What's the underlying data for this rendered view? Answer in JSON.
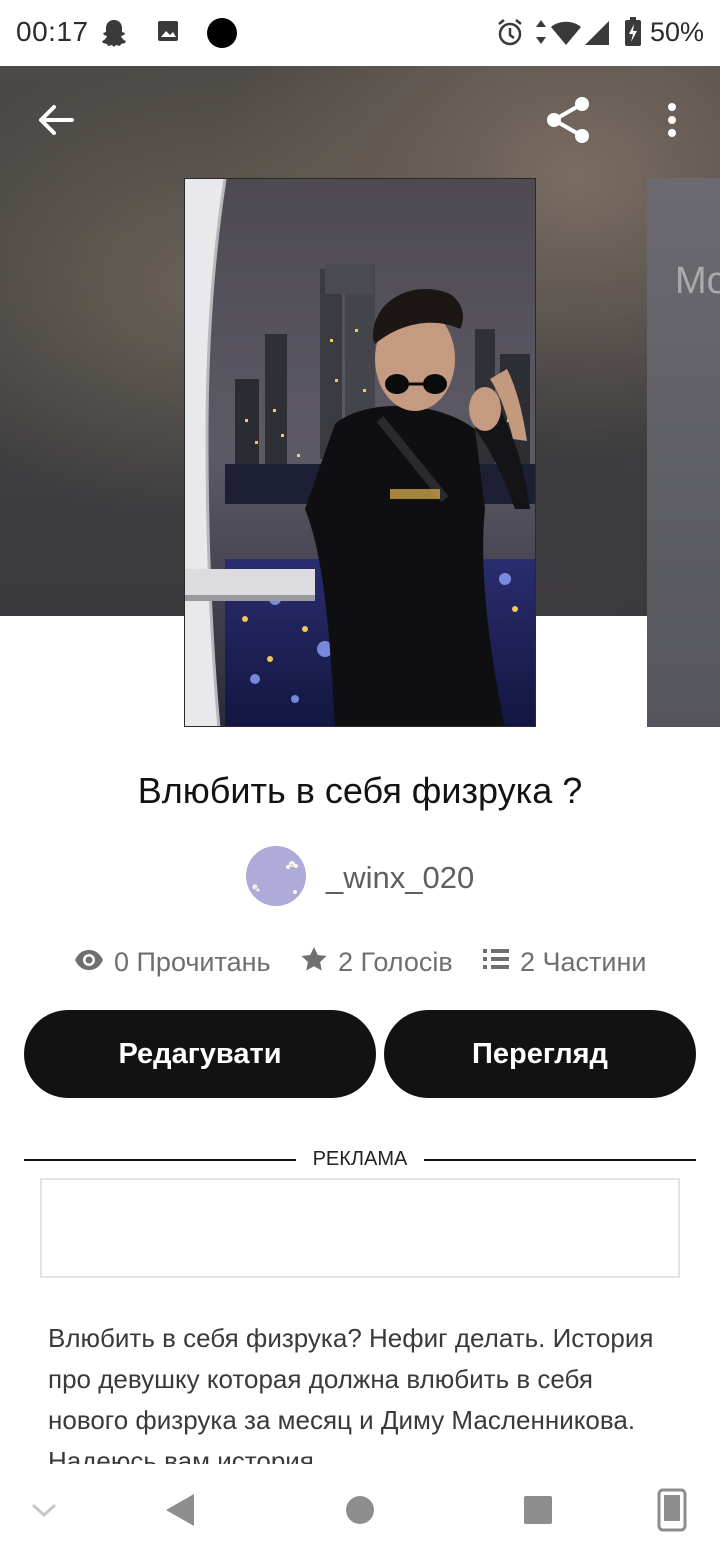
{
  "status_bar": {
    "time": "00:17",
    "battery": "50%",
    "icons": [
      "snapchat-icon",
      "gallery-icon",
      "dot-icon",
      "alarm-icon",
      "data-arrows-icon",
      "wifi-icon",
      "signal-icon",
      "battery-charging-icon"
    ]
  },
  "header": {
    "back_icon": "arrow-left-icon",
    "share_icon": "share-icon",
    "more_icon": "more-vertical-icon"
  },
  "next_cover": {
    "partial_text": "Mo"
  },
  "story": {
    "title": "Влюбить в себя физрука ?",
    "author": "_winx_020"
  },
  "stats": {
    "reads": "0 Прочитань",
    "votes": "2 Голосів",
    "parts": "2 Частини"
  },
  "actions": {
    "edit_label": "Редагувати",
    "preview_label": "Перегляд"
  },
  "ad": {
    "label": "РЕКЛАМА"
  },
  "description": "Влюбить в себя физрука? Нефиг делать. История про девушку которая должна влюбить в себя нового физрука за месяц и Диму Масленникова. Надеюсь вам история",
  "colors": {
    "button_bg": "#121212",
    "button_text": "#ffffff",
    "avatar_bg": "#aeabd8"
  }
}
